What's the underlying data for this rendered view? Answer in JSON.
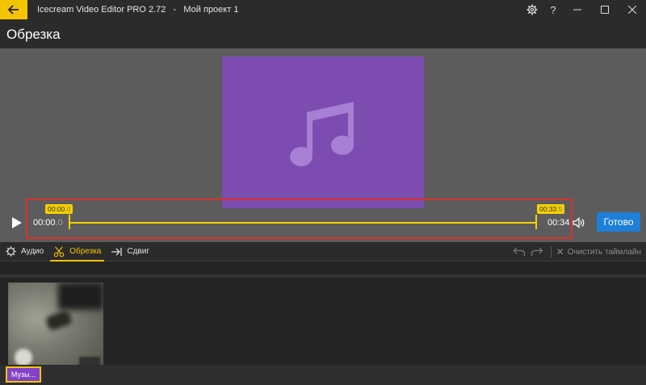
{
  "app": {
    "window_title": "Icecream Video Editor PRO 2.72   -   Мой проект 1"
  },
  "header": {
    "title": "Обрезка"
  },
  "player": {
    "time_start_main": "00:00",
    "time_start_frac": ".0",
    "time_end": "00:34",
    "trim_start_tag_main": "00:00",
    "trim_start_tag_frac": ".0",
    "trim_end_tag_main": "00:33",
    "trim_end_tag_frac": ".5",
    "done_label": "Готово"
  },
  "toolbar": {
    "audio_label": "Аудио",
    "trim_label": "Обрезка",
    "shift_label": "Сдвиг",
    "clear_label": "Очистить таймлайн"
  },
  "timeline": {
    "music_chip_label": "Музы..."
  },
  "colors": {
    "accent": "#f5c400",
    "artwork": "#7d4cb1",
    "done_button": "#1d7fd8",
    "highlight_border": "#d9302c"
  },
  "icons": {
    "back": "arrow-left-icon",
    "settings": "gear-icon",
    "help": "question-icon",
    "music": "music-note-icon",
    "play": "play-icon",
    "volume": "speaker-icon",
    "trim": "scissors-icon",
    "shift": "arrow-right-bar-icon",
    "undo": "undo-icon",
    "redo": "redo-icon",
    "clear": "close-icon"
  }
}
